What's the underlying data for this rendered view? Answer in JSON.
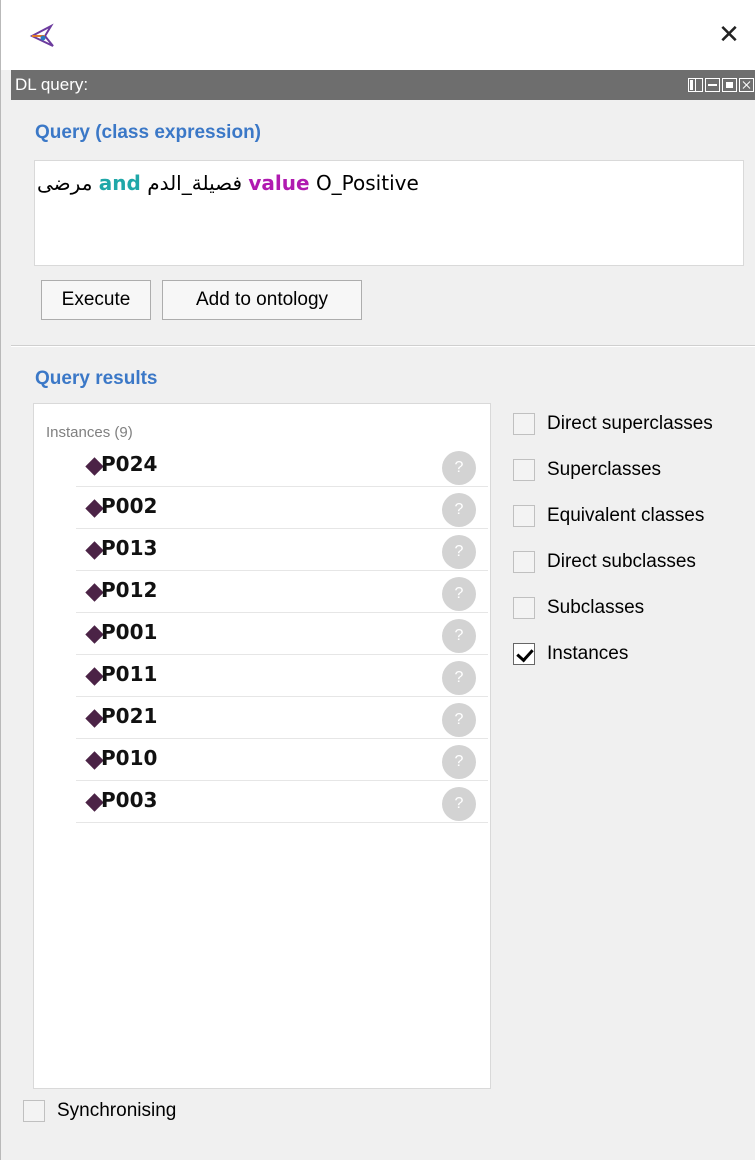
{
  "window": {
    "close_glyph": "✕"
  },
  "panel": {
    "title": "DL query:"
  },
  "query": {
    "section_title": "Query (class expression)",
    "expression": {
      "class_arabic": "مرضى",
      "kw_and": "and",
      "property_arabic": "فصيلة_الدم",
      "kw_value": "value",
      "individual": "O_Positive"
    },
    "execute_label": "Execute",
    "add_label": "Add to ontology"
  },
  "results": {
    "section_title": "Query results",
    "caption": "Instances (9)",
    "items": [
      {
        "label": "P024"
      },
      {
        "label": "P002"
      },
      {
        "label": "P013"
      },
      {
        "label": "P012"
      },
      {
        "label": "P001"
      },
      {
        "label": "P011"
      },
      {
        "label": "P021"
      },
      {
        "label": "P010"
      },
      {
        "label": "P003"
      }
    ],
    "help_glyph": "?"
  },
  "options": [
    {
      "label": "Direct superclasses",
      "checked": false
    },
    {
      "label": "Superclasses",
      "checked": false
    },
    {
      "label": "Equivalent classes",
      "checked": false
    },
    {
      "label": "Direct subclasses",
      "checked": false
    },
    {
      "label": "Subclasses",
      "checked": false
    },
    {
      "label": "Instances",
      "checked": true
    }
  ],
  "sync": {
    "label": "Synchronising",
    "checked": false
  },
  "colors": {
    "accent": "#3b78c7",
    "keyword_and": "#1fa7a8",
    "keyword_value": "#b01ab0",
    "individual_icon": "#4b2346",
    "header_bg": "#6e6e6e"
  }
}
